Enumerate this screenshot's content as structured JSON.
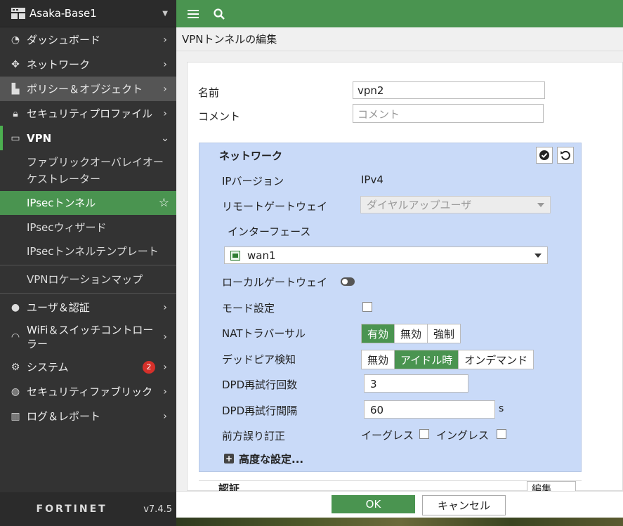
{
  "sidebar": {
    "device_name": "Asaka-Base1",
    "items": [
      {
        "label": "ダッシュボード",
        "icon": "dashboard-icon"
      },
      {
        "label": "ネットワーク",
        "icon": "network-icon"
      },
      {
        "label": "ポリシー＆オブジェクト",
        "icon": "policy-icon"
      },
      {
        "label": "セキュリティプロファイル",
        "icon": "lock-icon"
      },
      {
        "label": "VPN",
        "icon": "laptop-icon"
      }
    ],
    "vpn_sub": [
      {
        "label": "ファブリックオーバレイオーケストレーター"
      },
      {
        "label": "IPsecトンネル"
      },
      {
        "label": "IPsecウィザード"
      },
      {
        "label": "IPsecトンネルテンプレート"
      },
      {
        "label": "VPNロケーションマップ"
      }
    ],
    "items2": [
      {
        "label": "ユーザ＆認証",
        "icon": "user-icon"
      },
      {
        "label": "WiFi＆スイッチコントローラー",
        "icon": "wifi-icon"
      },
      {
        "label": "システム",
        "icon": "gear-icon",
        "badge": "2"
      },
      {
        "label": "セキュリティファブリック",
        "icon": "fabric-icon"
      },
      {
        "label": "ログ＆レポート",
        "icon": "chart-icon"
      }
    ],
    "logo": "FORTINET",
    "version": "v7.4.5"
  },
  "page_title": "VPNトンネルの編集",
  "form": {
    "name_label": "名前",
    "name_value": "vpn2",
    "comment_label": "コメント",
    "comment_placeholder": "コメント"
  },
  "network": {
    "title": "ネットワーク",
    "ip_version_label": "IPバージョン",
    "ip_version_value": "IPv4",
    "remote_gw_label": "リモートゲートウェイ",
    "remote_gw_value": "ダイヤルアップユーザ",
    "interface_label": "インターフェース",
    "interface_value": "wan1",
    "local_gw_label": "ローカルゲートウェイ",
    "mode_config_label": "モード設定",
    "nat_label": "NATトラバーサル",
    "nat_options": [
      "有効",
      "無効",
      "強制"
    ],
    "dpd_label": "デッドピア検知",
    "dpd_options": [
      "無効",
      "アイドル時",
      "オンデマンド"
    ],
    "dpd_retry_count_label": "DPD再試行回数",
    "dpd_retry_count_value": "3",
    "dpd_retry_interval_label": "DPD再試行間隔",
    "dpd_retry_interval_value": "60",
    "dpd_retry_interval_unit": "s",
    "fec_label": "前方誤り訂正",
    "fec_egress": "イーグレス",
    "fec_ingress": "イングレス",
    "advanced_label": "高度な設定..."
  },
  "auth": {
    "title": "認証",
    "edit_label": "編集"
  },
  "footer": {
    "ok": "OK",
    "cancel": "キャンセル"
  }
}
